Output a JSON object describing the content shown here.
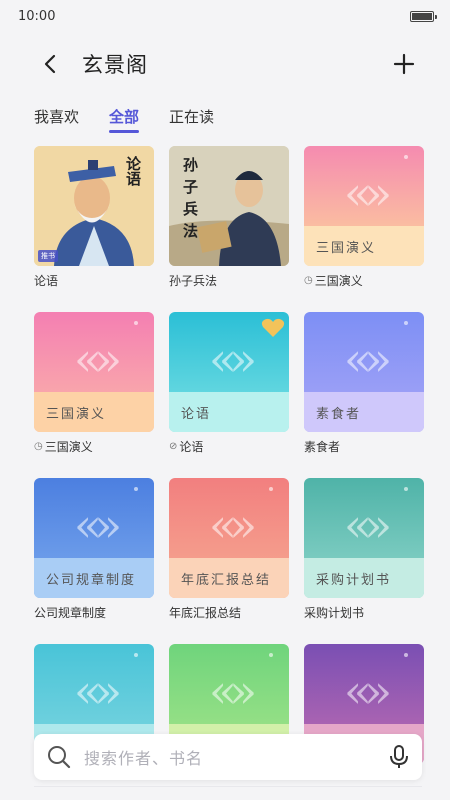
{
  "status_bar": {
    "time": "10:00"
  },
  "header": {
    "title": "玄景阁"
  },
  "tabs": [
    {
      "label": "我喜欢",
      "active": false
    },
    {
      "label": "全部",
      "active": true
    },
    {
      "label": "正在读",
      "active": false
    }
  ],
  "books": [
    {
      "title": "论语",
      "cover_type": "illustration",
      "cover_text": "论语",
      "tag": "推书"
    },
    {
      "title": "孙子兵法",
      "cover_type": "illustration",
      "cover_text": "孙子兵法"
    },
    {
      "title": "三国演义",
      "cover_type": "gradient",
      "band_text": "三国演义",
      "status_icon": "clock-icon",
      "colors": [
        "#f58bb0",
        "#fdd59a"
      ],
      "band": "#fde2b9"
    },
    {
      "title": "三国演义",
      "cover_type": "gradient",
      "band_text": "三国演义",
      "status_icon": "clock-icon",
      "colors": [
        "#f47fb2",
        "#fbb7a9"
      ],
      "band": "#fdd2a6"
    },
    {
      "title": "论语",
      "cover_type": "gradient",
      "band_text": "论语",
      "status_icon": "check-icon",
      "favorite": true,
      "colors": [
        "#2bbfd6",
        "#7ae1e4"
      ],
      "band": "#b8f1ee"
    },
    {
      "title": "素食者",
      "cover_type": "gradient",
      "band_text": "素食者",
      "colors": [
        "#7d8ff5",
        "#a8a6f6"
      ],
      "band": "#cfc8fb"
    },
    {
      "title": "公司规章制度",
      "cover_type": "gradient",
      "band_text": "公司规章制度",
      "colors": [
        "#4c7fe0",
        "#7aa9ee"
      ],
      "band": "#a9cdf5"
    },
    {
      "title": "年底汇报总结",
      "cover_type": "gradient",
      "band_text": "年底汇报总结",
      "colors": [
        "#f27f7f",
        "#f6ab92"
      ],
      "band": "#fbd3b8"
    },
    {
      "title": "采购计划书",
      "cover_type": "gradient",
      "band_text": "采购计划书",
      "colors": [
        "#4fb3a8",
        "#8fd6cb"
      ],
      "band": "#c4ece3"
    },
    {
      "title": "",
      "cover_type": "gradient",
      "band_text": "",
      "colors": [
        "#49c4d8",
        "#7fd6e0"
      ],
      "band": "#aee8ec"
    },
    {
      "title": "",
      "cover_type": "gradient",
      "band_text": "",
      "colors": [
        "#6fd47c",
        "#a6e58a"
      ],
      "band": "#d2f0a9"
    },
    {
      "title": "",
      "cover_type": "gradient",
      "band_text": "",
      "colors": [
        "#7a4fb3",
        "#c06db2"
      ],
      "band": "#e5a7c8"
    }
  ],
  "search": {
    "placeholder": "搜索作者、书名"
  },
  "colors": {
    "accent": "#5557d8",
    "background": "#f4f4f6"
  }
}
